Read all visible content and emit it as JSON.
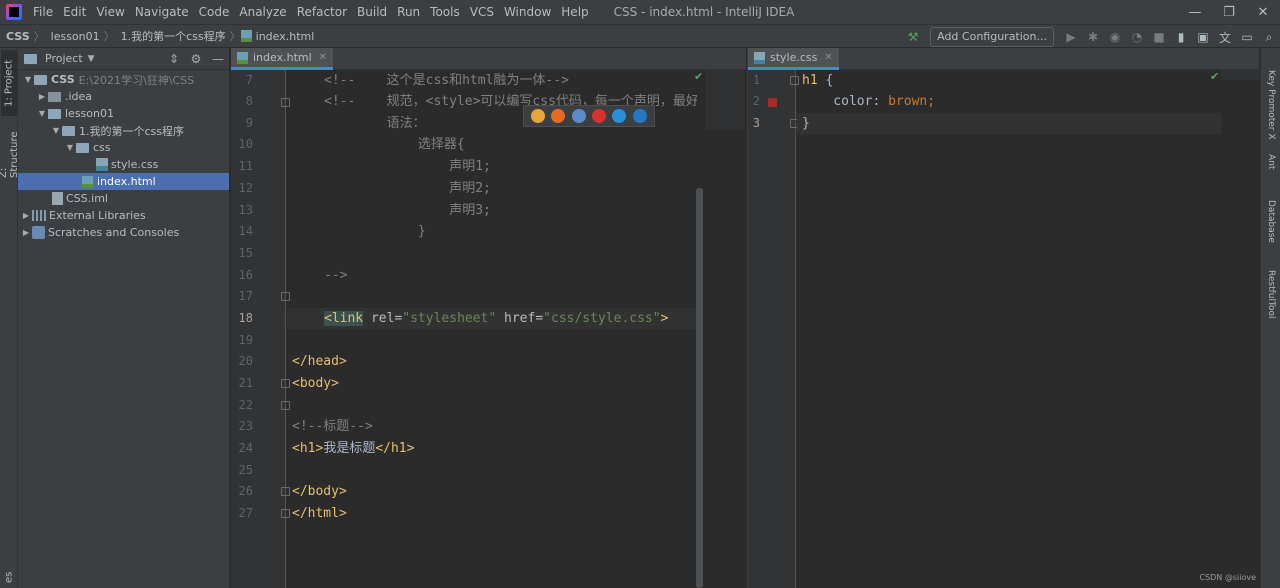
{
  "menu": {
    "items": [
      "File",
      "Edit",
      "View",
      "Navigate",
      "Code",
      "Analyze",
      "Refactor",
      "Build",
      "Run",
      "Tools",
      "VCS",
      "Window",
      "Help"
    ],
    "window_title": "CSS - index.html - IntelliJ IDEA"
  },
  "breadcrumbs": [
    "CSS",
    "lesson01",
    "1.我的第一个css程序",
    "index.html"
  ],
  "toolbar": {
    "add_configuration": "Add Configuration..."
  },
  "left_stripe": {
    "project_tab": "1: Project",
    "structure_tab": "Z: Structure",
    "favorites_tab": "es"
  },
  "project_panel": {
    "title": "Project",
    "tree": [
      {
        "label": "CSS",
        "extra": "E:\\2021学习\\狂神\\CSS"
      },
      {
        "label": ".idea"
      },
      {
        "label": "lesson01"
      },
      {
        "label": "1.我的第一个css程序"
      },
      {
        "label": "css"
      },
      {
        "label": "style.css"
      },
      {
        "label": "index.html"
      },
      {
        "label": "CSS.iml"
      },
      {
        "label": "External Libraries"
      },
      {
        "label": "Scratches and Consoles"
      }
    ]
  },
  "editor_html": {
    "tab_label": "index.html",
    "line_numbers": [
      "7",
      "8",
      "9",
      "10",
      "11",
      "12",
      "13",
      "14",
      "15",
      "16",
      "17",
      "18",
      "19",
      "20",
      "21",
      "22",
      "23",
      "24",
      "25",
      "26",
      "27"
    ],
    "current_line": "18",
    "lines": {
      "l7a": "<!--    ",
      "l7b": "这个是css和html融为一体-->",
      "l8a": "<!--    ",
      "l8b": "规范，<style>可以编写css代码，每一个声明，最好",
      "l9": "        语法：",
      "l10": "            选择器{",
      "l11": "                声明1;",
      "l12": "                声明2;",
      "l13": "                声明3;",
      "l14": "            }",
      "l16": "-->",
      "l18_open": "<",
      "l18_tag": "link",
      "l18_attr1": " rel=",
      "l18_val1": "\"stylesheet\"",
      "l18_attr2": " href=",
      "l18_val2": "\"css/style.css\"",
      "l18_close": ">",
      "l20_open": "</",
      "l20_tag": "head",
      "l20_close": ">",
      "l21_open": "<",
      "l21_tag": "body",
      "l21_close": ">",
      "l23": "<!--标题-->",
      "l24_open": "<",
      "l24_tag": "h1",
      "l24_mid": ">",
      "l24_text": "我是标题",
      "l24_end_open": "</",
      "l24_end_tag": "h1",
      "l24_end_close": ">",
      "l26_open": "</",
      "l26_tag": "body",
      "l26_close": ">",
      "l27_open": "</",
      "l27_tag": "html",
      "l27_close": ">"
    }
  },
  "editor_css": {
    "tab_label": "style.css",
    "line_numbers": [
      "1",
      "2",
      "3"
    ],
    "lines": {
      "l1_sel": "h1",
      "l1_brace": " {",
      "l2_prop": "    color",
      "l2_colon": ": ",
      "l2_val": "brown",
      "l2_semi": ";",
      "l3": "}"
    },
    "color_swatch": "#a52a2a"
  },
  "right_stripe": {
    "tabs": [
      "Key Promoter X",
      "Ant",
      "Database",
      "RestfulTool"
    ]
  },
  "watermark": "CSDN @siiove",
  "colors": {
    "background": "#2b2b2b",
    "panel": "#3c3f41",
    "selection": "#4b6eaf",
    "tag": "#e8bf6a",
    "string": "#6a8759",
    "keyword": "#cc7832",
    "comment": "#808080"
  }
}
